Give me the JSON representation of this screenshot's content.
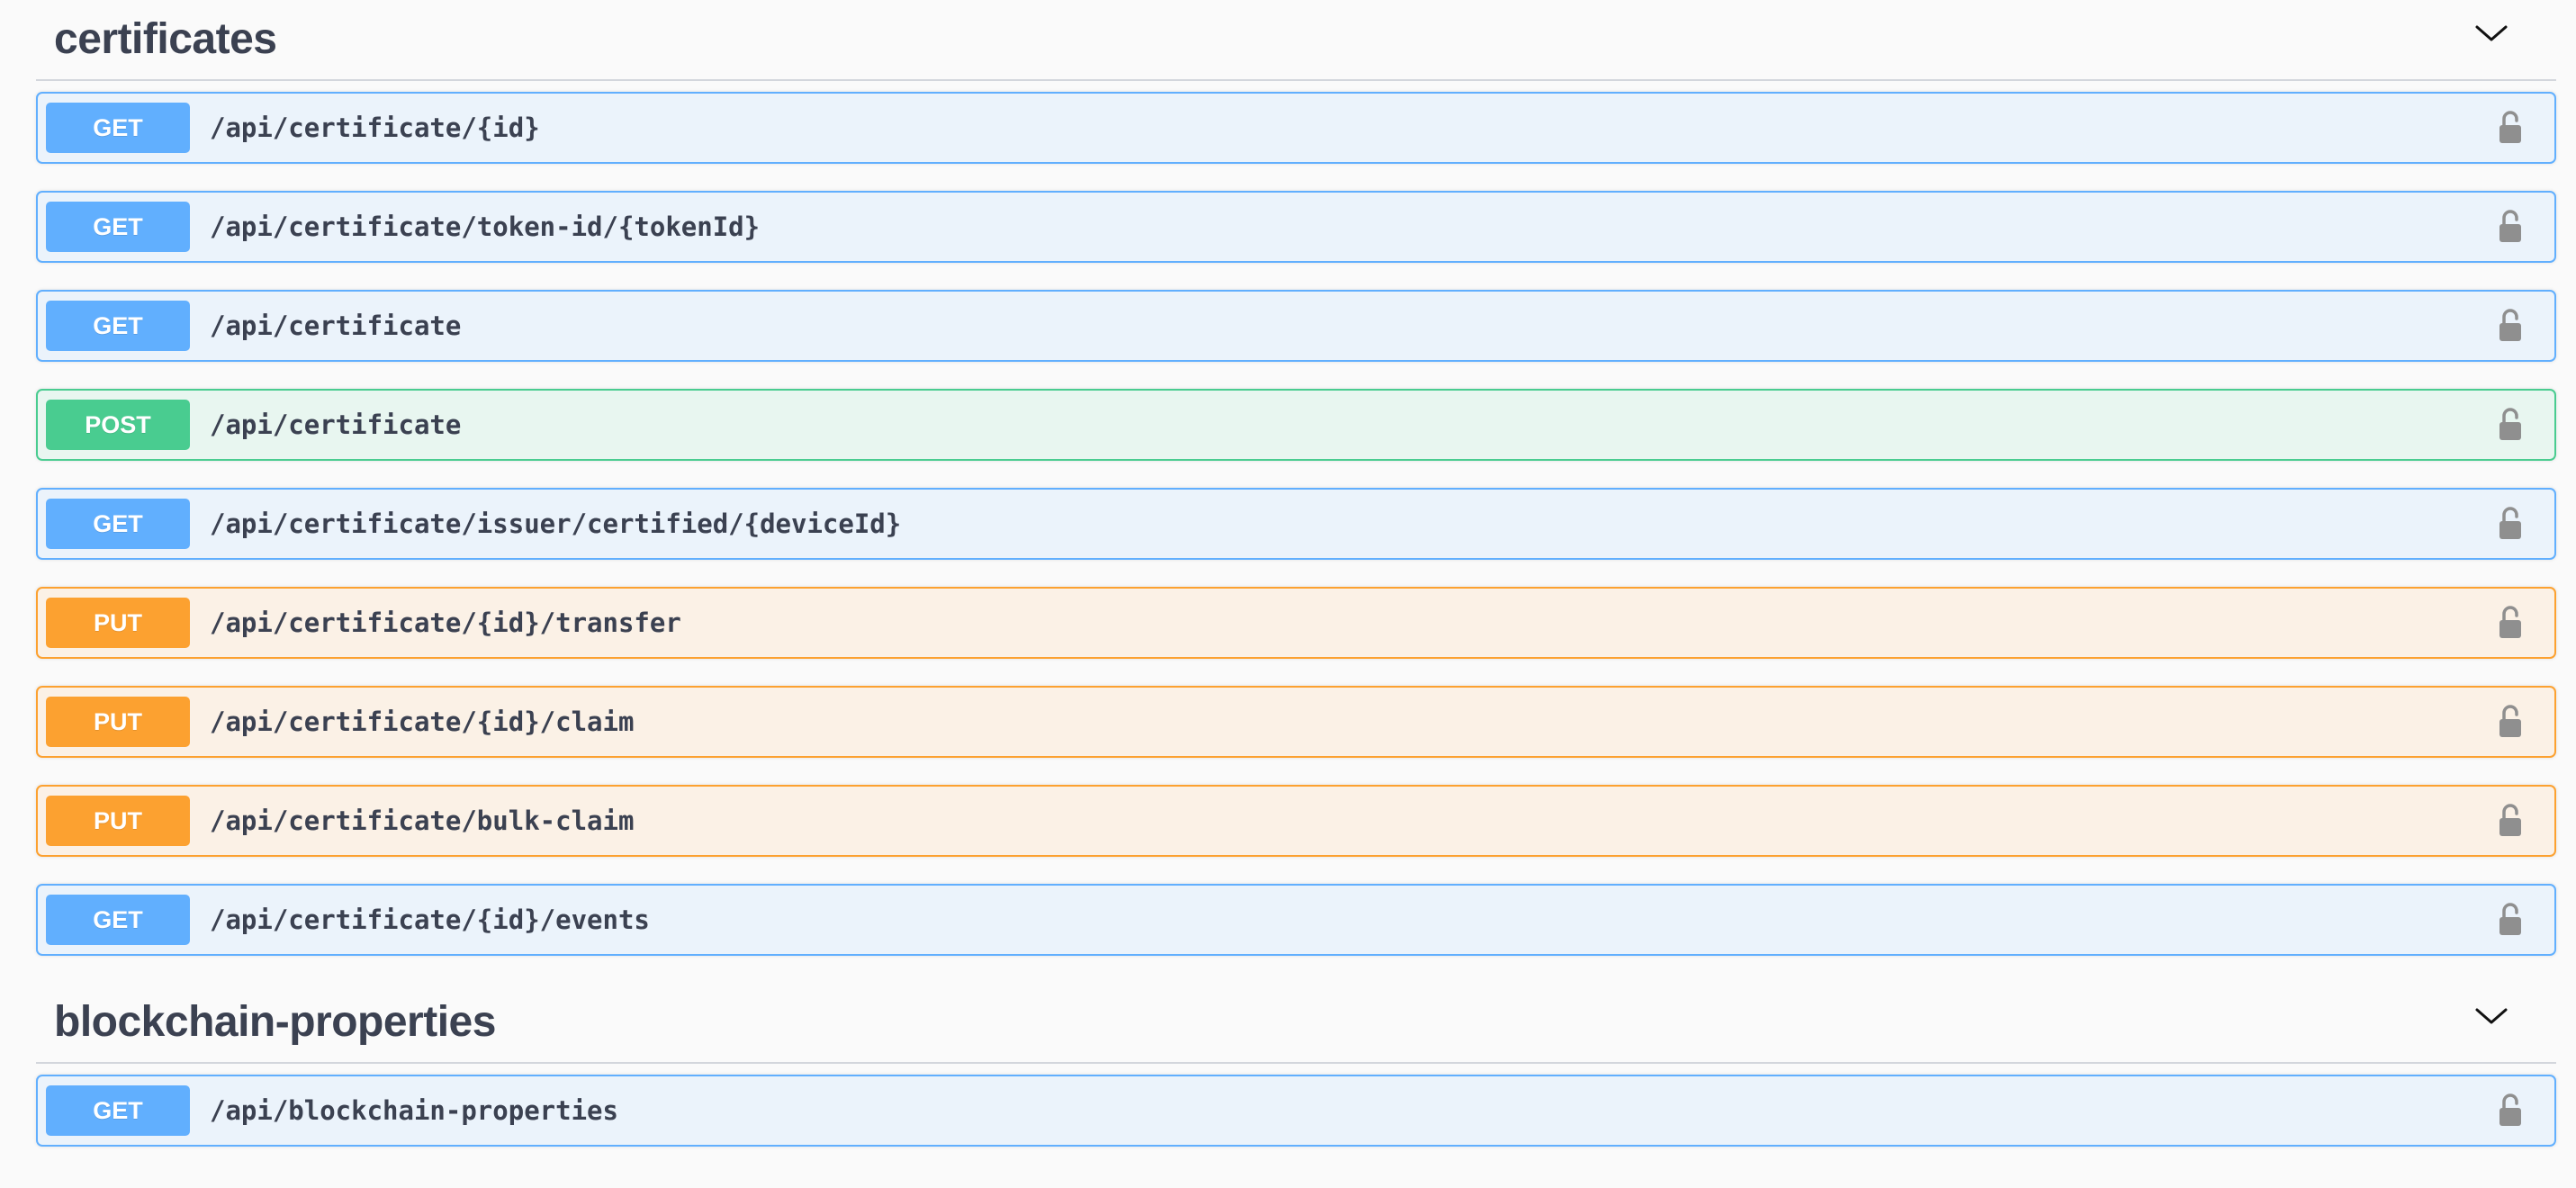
{
  "colors": {
    "get": "#61affe",
    "post": "#49cc90",
    "put": "#fca130",
    "text": "#3b4151",
    "lock": "#8f8f8f"
  },
  "sections": [
    {
      "title": "certificates",
      "toggle_icon": "chevron-down-icon",
      "operations": [
        {
          "method": "GET",
          "path": "/api/certificate/{id}"
        },
        {
          "method": "GET",
          "path": "/api/certificate/token-id/{tokenId}"
        },
        {
          "method": "GET",
          "path": "/api/certificate"
        },
        {
          "method": "POST",
          "path": "/api/certificate"
        },
        {
          "method": "GET",
          "path": "/api/certificate/issuer/certified/{deviceId}"
        },
        {
          "method": "PUT",
          "path": "/api/certificate/{id}/transfer"
        },
        {
          "method": "PUT",
          "path": "/api/certificate/{id}/claim"
        },
        {
          "method": "PUT",
          "path": "/api/certificate/bulk-claim"
        },
        {
          "method": "GET",
          "path": "/api/certificate/{id}/events"
        }
      ]
    },
    {
      "title": "blockchain-properties",
      "toggle_icon": "chevron-down-icon",
      "operations": [
        {
          "method": "GET",
          "path": "/api/blockchain-properties"
        }
      ]
    }
  ],
  "operation_icon": "lock-icon"
}
